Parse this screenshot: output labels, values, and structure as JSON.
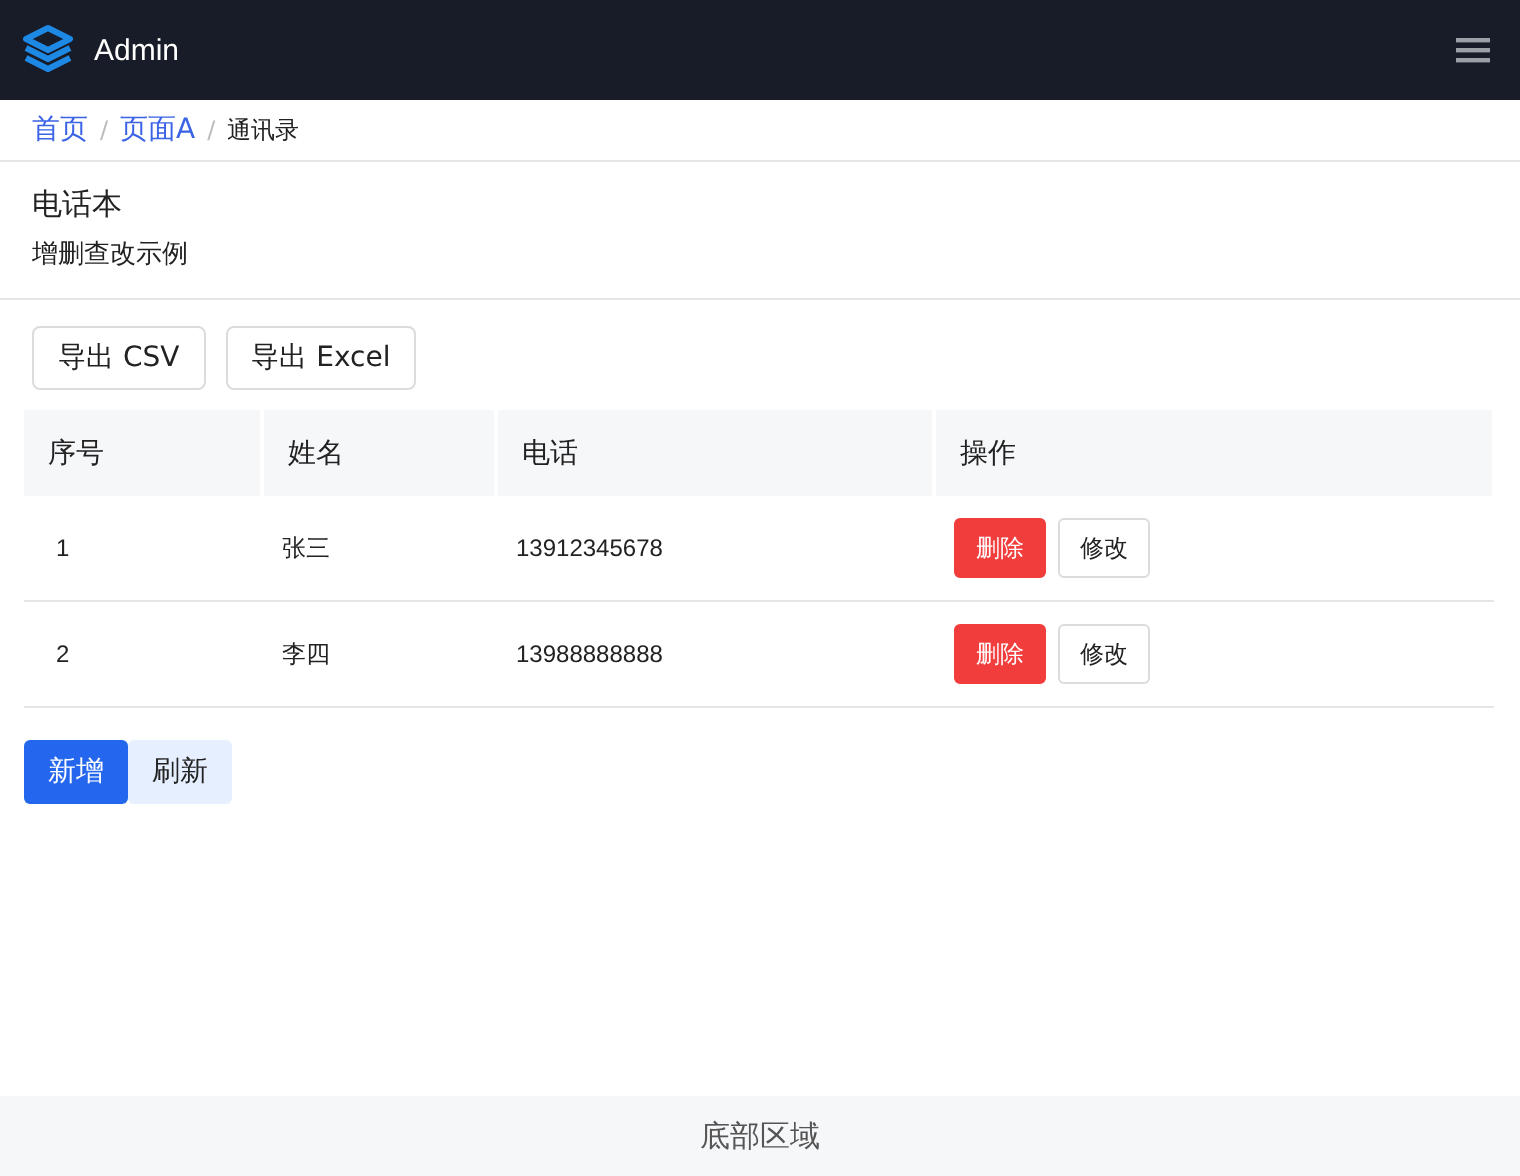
{
  "header": {
    "title": "Admin"
  },
  "breadcrumb_separator": "/",
  "breadcrumb": [
    {
      "label": "首页",
      "current": false
    },
    {
      "label": "页面A",
      "current": false
    },
    {
      "label": "通讯录",
      "current": true
    }
  ],
  "page": {
    "title": "电话本",
    "subtitle": "增删查改示例"
  },
  "export_buttons": [
    "导出 CSV",
    "导出 Excel"
  ],
  "table": {
    "columns": [
      "序号",
      "姓名",
      "电话",
      "操作"
    ],
    "rows": [
      {
        "cells": [
          "1",
          "张三",
          "13912345678"
        ],
        "actions": [
          {
            "label": "删除",
            "kind": "danger"
          },
          {
            "label": "修改",
            "kind": "default"
          }
        ]
      },
      {
        "cells": [
          "2",
          "李四",
          "13988888888"
        ],
        "actions": [
          {
            "label": "删除",
            "kind": "danger"
          },
          {
            "label": "修改",
            "kind": "default"
          }
        ]
      }
    ]
  },
  "bottom_buttons": [
    {
      "label": "新增",
      "kind": "primary"
    },
    {
      "label": "刷新",
      "kind": "secondary"
    }
  ],
  "footer": "底部区域"
}
